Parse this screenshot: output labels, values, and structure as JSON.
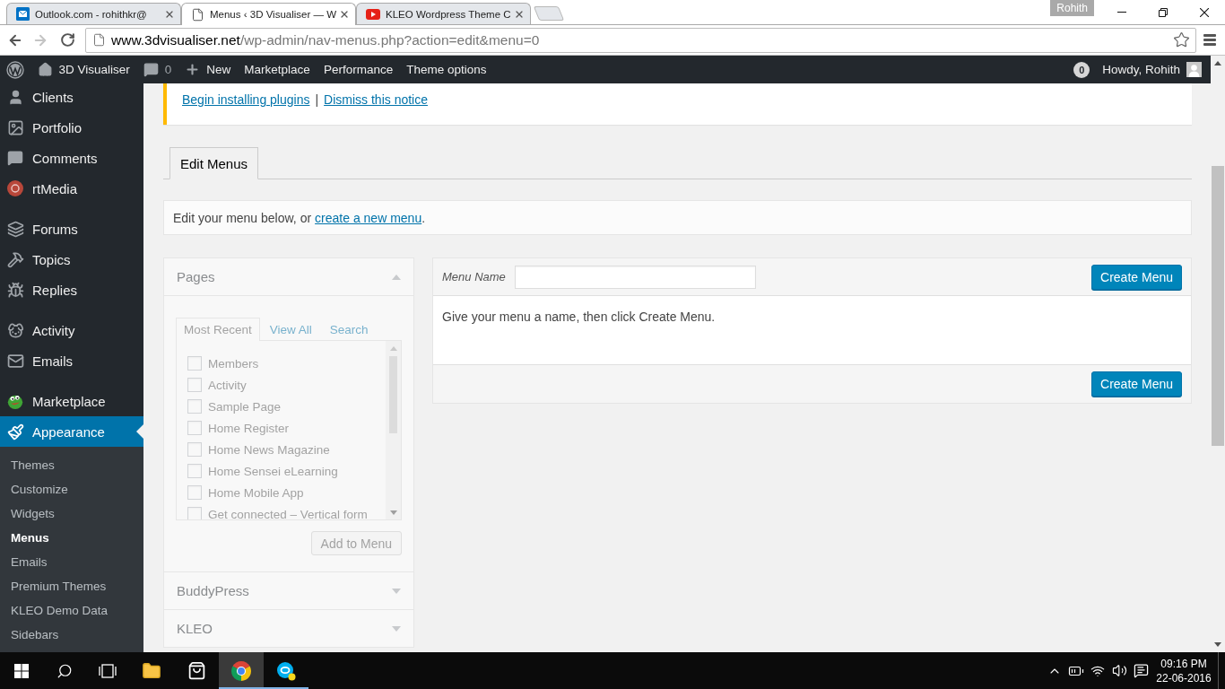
{
  "browser": {
    "tabs": [
      {
        "title": "Outlook.com - rohithkr@",
        "selected": false
      },
      {
        "title": "Menus ‹ 3D Visualiser — W",
        "selected": true
      },
      {
        "title": "KLEO Wordpress Theme C",
        "selected": false
      }
    ],
    "profile": "Rohith",
    "navigation": {
      "forward_enabled": false
    },
    "url": {
      "host": "www.3dvisualiser.net",
      "path": "/wp-admin/nav-menus.php?action=edit&menu=0"
    }
  },
  "admin_bar": {
    "items": [
      {
        "kind": "site",
        "label": "3D Visualiser"
      },
      {
        "kind": "comments",
        "label": "0"
      },
      {
        "kind": "new",
        "label": "New"
      },
      {
        "kind": "link",
        "label": "Marketplace"
      },
      {
        "kind": "link",
        "label": "Performance"
      },
      {
        "kind": "link",
        "label": "Theme options"
      }
    ],
    "notifications": "0",
    "greeting": "Howdy, Rohith"
  },
  "sidebar": {
    "groups": [
      {
        "items": [
          {
            "label": "Clients",
            "selected": false
          },
          {
            "label": "Portfolio",
            "selected": false
          },
          {
            "label": "Comments",
            "selected": false
          },
          {
            "label": "rtMedia",
            "selected": false
          }
        ]
      },
      {
        "items": [
          {
            "label": "Forums",
            "selected": false
          },
          {
            "label": "Topics",
            "selected": false
          },
          {
            "label": "Replies",
            "selected": false
          }
        ]
      },
      {
        "items": [
          {
            "label": "Activity",
            "selected": false
          },
          {
            "label": "Emails",
            "selected": false
          }
        ]
      },
      {
        "items": [
          {
            "label": "Marketplace",
            "selected": false
          },
          {
            "label": "Appearance",
            "selected": true,
            "submenu": [
              {
                "label": "Themes",
                "selected": false
              },
              {
                "label": "Customize",
                "selected": false
              },
              {
                "label": "Widgets",
                "selected": false
              },
              {
                "label": "Menus",
                "selected": true
              },
              {
                "label": "Emails",
                "selected": false
              },
              {
                "label": "Premium Themes",
                "selected": false
              },
              {
                "label": "KLEO Demo Data",
                "selected": false
              },
              {
                "label": "Sidebars",
                "selected": false
              }
            ]
          }
        ]
      }
    ]
  },
  "notice": {
    "links": [
      "Begin installing plugins",
      "Dismiss this notice"
    ],
    "separator": "|"
  },
  "nav_tabs": [
    {
      "label": "Edit Menus",
      "selected": true
    }
  ],
  "manage_menus": {
    "text": "Edit your menu below, or",
    "link": "create a new menu",
    "end": "."
  },
  "menu_items_panel": {
    "disabled": true,
    "sections": [
      {
        "title": "Pages",
        "expanded": true,
        "tabs": [
          {
            "label": "Most Recent",
            "selected": true
          },
          {
            "label": "View All",
            "selected": false
          },
          {
            "label": "Search",
            "selected": false
          }
        ],
        "items": [
          {
            "label": "Members",
            "checked": false
          },
          {
            "label": "Activity",
            "checked": false
          },
          {
            "label": "Sample Page",
            "checked": false
          },
          {
            "label": "Home Register",
            "checked": false
          },
          {
            "label": "Home News Magazine",
            "checked": false
          },
          {
            "label": "Home Sensei eLearning",
            "checked": false
          },
          {
            "label": "Home Mobile App",
            "checked": false
          },
          {
            "label": "Get connected – Vertical form",
            "checked": false
          }
        ],
        "button": "Add to Menu"
      },
      {
        "title": "BuddyPress",
        "expanded": false
      },
      {
        "title": "KLEO",
        "expanded": false
      }
    ]
  },
  "menu_editor": {
    "name_label": "Menu Name",
    "header_button": "Create Menu",
    "message": "Give your menu a name, then click Create Menu.",
    "footer_button": "Create Menu"
  },
  "taskbar": {
    "apps": [
      {
        "running": false,
        "selected": false
      },
      {
        "running": false,
        "selected": false
      },
      {
        "running": true,
        "selected": true
      },
      {
        "running": true,
        "selected": false
      }
    ],
    "time": "09:16 PM",
    "date": "22-06-2016"
  }
}
